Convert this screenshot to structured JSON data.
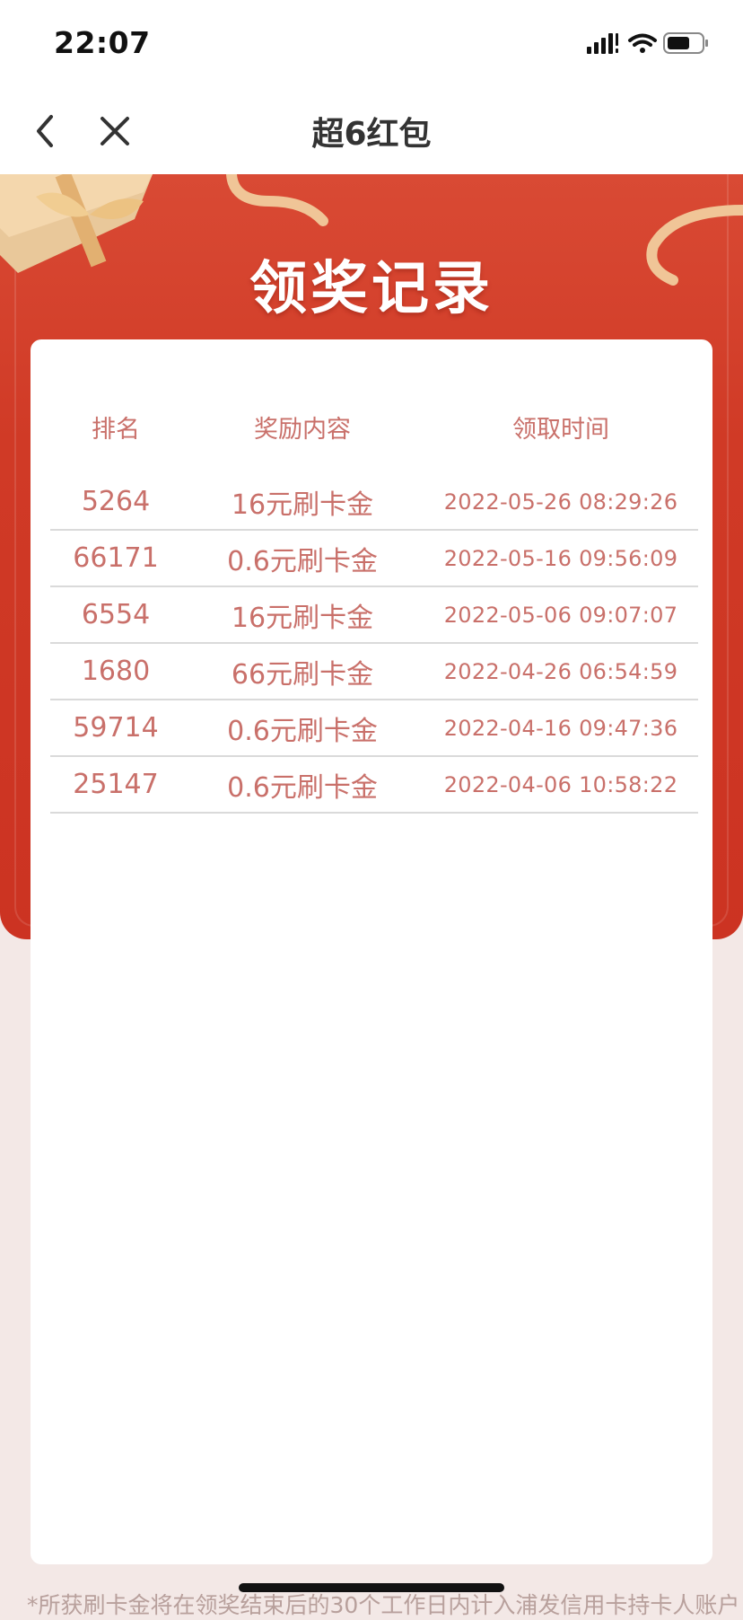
{
  "status_bar": {
    "time": "22:07",
    "signal_icon": "signal-icon",
    "wifi_icon": "wifi-icon",
    "battery_icon": "battery-icon"
  },
  "nav": {
    "back_icon": "chevron-left-icon",
    "close_icon": "close-icon",
    "title": "超6红包"
  },
  "banner": {
    "title": "领奖记录",
    "background_color": "#d03a26",
    "decorations": [
      "gift-box-icon",
      "ribbon-icon"
    ]
  },
  "table": {
    "headers": {
      "rank": "排名",
      "reward": "奖励内容",
      "time": "领取时间"
    },
    "rows": [
      {
        "rank": "5264",
        "reward": "16元刷卡金",
        "time": "2022-05-26 08:29:26"
      },
      {
        "rank": "66171",
        "reward": "0.6元刷卡金",
        "time": "2022-05-16 09:56:09"
      },
      {
        "rank": "6554",
        "reward": "16元刷卡金",
        "time": "2022-05-06 09:07:07"
      },
      {
        "rank": "1680",
        "reward": "66元刷卡金",
        "time": "2022-04-26 06:54:59"
      },
      {
        "rank": "59714",
        "reward": "0.6元刷卡金",
        "time": "2022-04-16 09:47:36"
      },
      {
        "rank": "25147",
        "reward": "0.6元刷卡金",
        "time": "2022-04-06 10:58:22"
      }
    ],
    "text_color": "#c9706a"
  },
  "footer": {
    "note": "*所获刷卡金将在领奖结束后的30个工作日内计入浦发信用卡持卡人账户"
  }
}
